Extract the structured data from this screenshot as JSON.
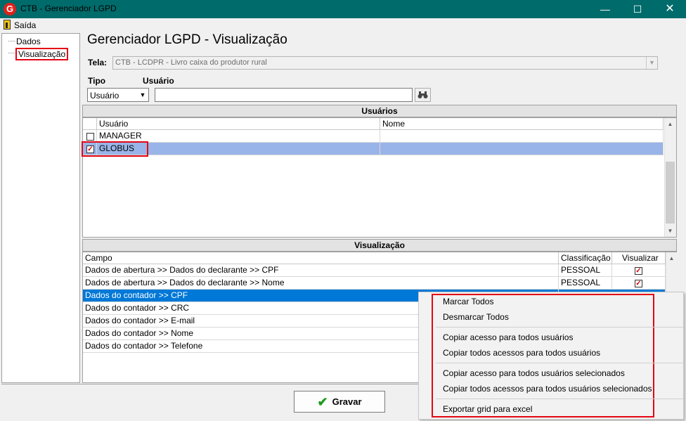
{
  "window": {
    "title": "CTB - Gerenciador LGPD",
    "logo_letter": "G",
    "minimize": "—",
    "maximize": "☐",
    "close": "✕"
  },
  "menu": {
    "exit": "Saída"
  },
  "tree": {
    "items": [
      {
        "label": "Dados"
      },
      {
        "label": "Visualização"
      }
    ]
  },
  "main": {
    "title": "Gerenciador LGPD - Visualização",
    "screen_label": "Tela:",
    "screen_value": "CTB - LCDPR - Livro caixa do produtor rural",
    "type_label": "Tipo",
    "user_label": "Usuário",
    "type_value": "Usuário",
    "user_value": ""
  },
  "users_grid": {
    "header": "Usuários",
    "columns": [
      "Usuário",
      "Nome"
    ],
    "rows": [
      {
        "user": "MANAGER",
        "name": "",
        "checked": false
      },
      {
        "user": "GLOBUS",
        "name": "",
        "checked": true
      }
    ]
  },
  "visual_grid": {
    "header": "Visualização",
    "columns": [
      "Campo",
      "Classificação",
      "Visualizar"
    ],
    "rows": [
      {
        "field": "Dados de abertura >>  Dados do declarante  >> CPF",
        "class": "PESSOAL",
        "visible": true
      },
      {
        "field": "Dados de abertura >>  Dados do declarante  >> Nome",
        "class": "PESSOAL",
        "visible": true
      },
      {
        "field": "Dados do contador >> CPF",
        "class": "",
        "visible": false
      },
      {
        "field": "Dados do contador >> CRC",
        "class": "",
        "visible": false
      },
      {
        "field": "Dados do contador >> E-mail",
        "class": "",
        "visible": false
      },
      {
        "field": "Dados do contador >> Nome",
        "class": "",
        "visible": false
      },
      {
        "field": "Dados do contador >> Telefone",
        "class": "",
        "visible": false
      }
    ]
  },
  "context_menu": {
    "items": [
      "Marcar Todos",
      "Desmarcar Todos",
      "Copiar acesso para todos usuários",
      "Copiar todos acessos para todos usuários",
      "Copiar acesso para todos usuários selecionados",
      "Copiar todos acessos para todos usuários selecionados",
      "Exportar grid para excel"
    ]
  },
  "footer": {
    "save": "Gravar"
  },
  "colors": {
    "titlebar": "#006b6b",
    "highlight": "#e30613",
    "selection": "#0078d7"
  }
}
